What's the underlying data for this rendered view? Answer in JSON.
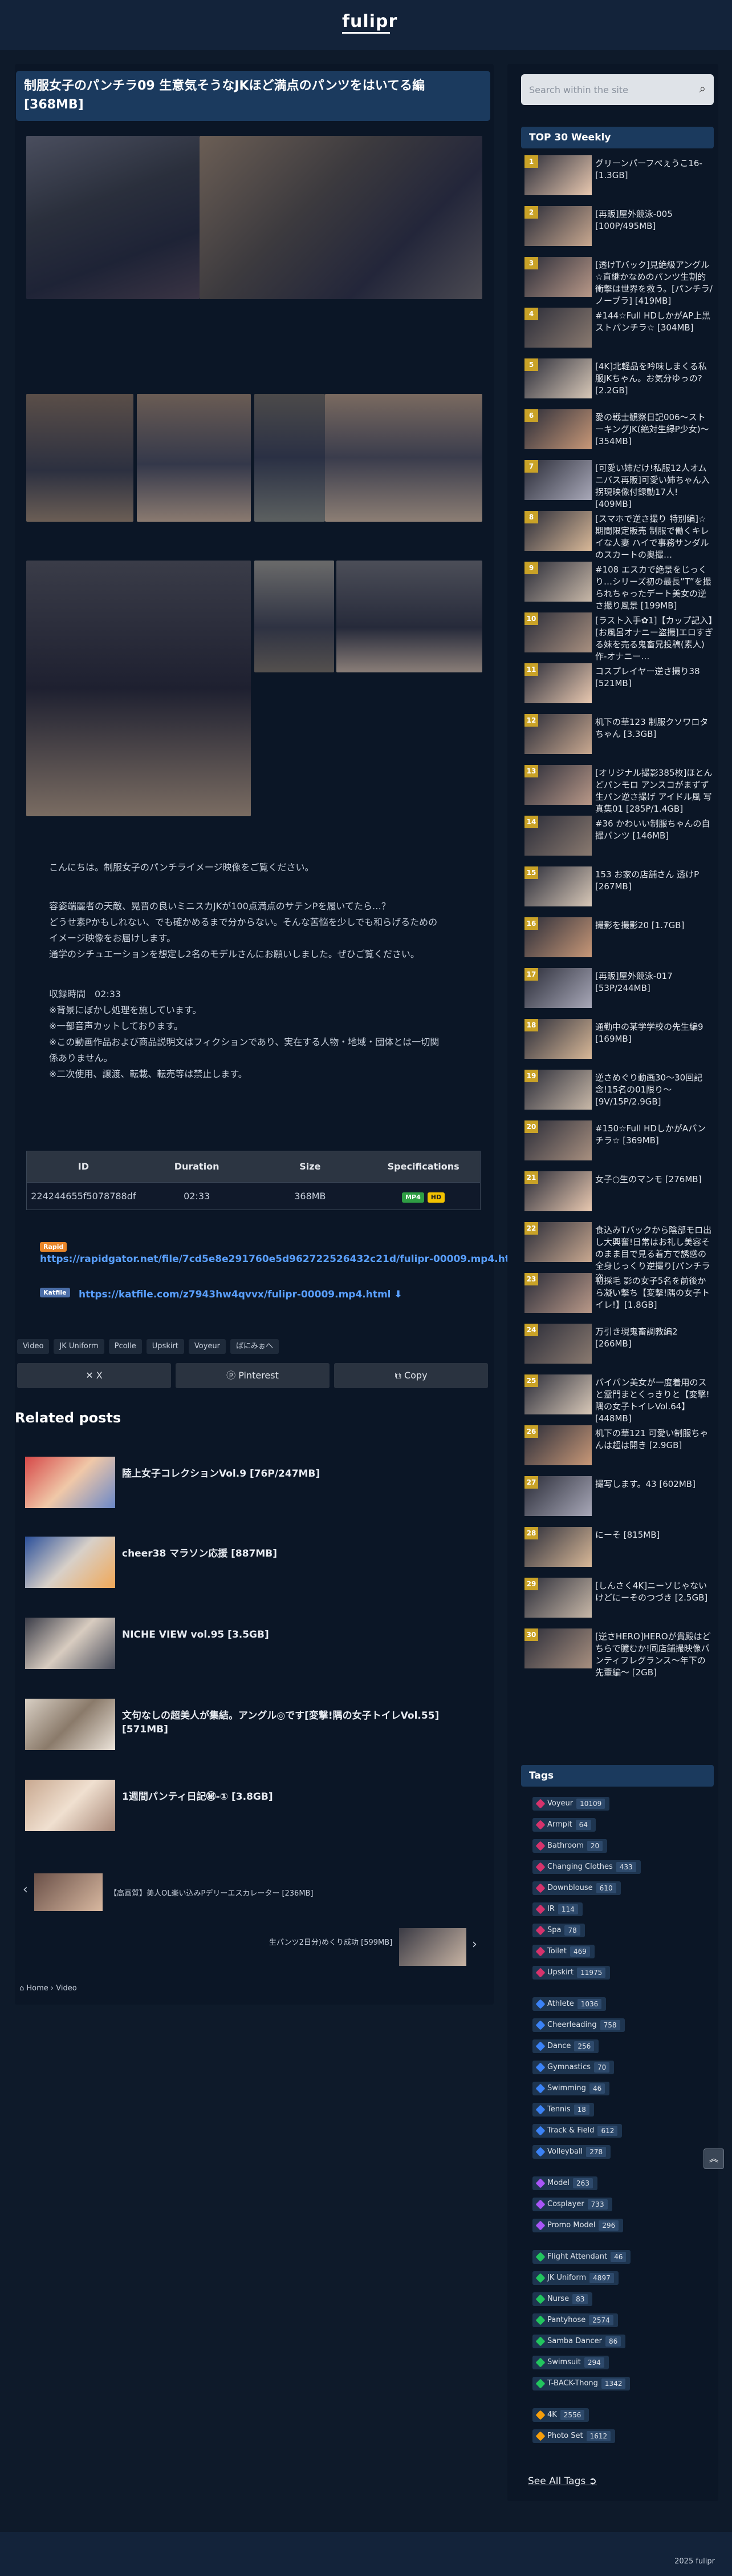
{
  "site": {
    "logo": "fulipr"
  },
  "post": {
    "title": "制服女子のパンチラ09 生意気そうなJKほど満点のパンツをはいてる編 [368MB]",
    "desc": [
      "こんにちは。制服女子のパンチライメージ映像をご覧ください。",
      "",
      "容姿端麗者の天敵、晃晋の良いミニスカJKが100点満点のサテンPを履いてたら…？",
      "どうせ素Pかもしれない、でも確かめるまで分からない。そんな苦悩を少しでも和らげるための",
      "イメージ映像をお届けします。",
      "通学のシチュエーションを想定し2名のモデルさんにお願いしました。ぜひご覧ください。",
      "",
      "収録時間　02:33",
      "※背景にぼかし処理を施しています。",
      "※一部音声カットしております。",
      "※この動画作品および商品説明文はフィクションであり、実在する人物・地域・団体とは一切関",
      "係ありません。",
      "※二次使用、譲渡、転載、転売等は禁止します。"
    ],
    "table": {
      "headers": [
        "ID",
        "Duration",
        "Size",
        "Specifications"
      ],
      "row": [
        "224244655f5078788df",
        "02:33",
        "368MB"
      ],
      "spec1": "MP4",
      "spec2": "HD"
    },
    "links": [
      {
        "badge": "Rapid",
        "url": "https://rapidgator.net/file/7cd5e8e291760e5d962722526432c21d/fulipr-00009.mp4.html ⬇"
      },
      {
        "badge": "Katfile",
        "url": "https://katfile.com/z7943hw4qvvx/fulipr-00009.mp4.html ⬇"
      }
    ],
    "tags": [
      "Video",
      "JK Uniform",
      "Pcolle",
      "Upskirt",
      "Voyeur",
      "ぱにみぉへ"
    ],
    "share": [
      "X",
      "Pinterest",
      "Copy"
    ]
  },
  "related": {
    "heading": "Related posts",
    "items": [
      "陸上女子コレクションVol.9 [76P/247MB]",
      "cheer38 マラソン応援 [887MB]",
      "NICHE VIEW vol.95 [3.5GB]",
      "文句なしの超美人が集結。アングル◎です[変撃!隅の女子トイレVol.55] [571MB]",
      "1週間パンティ日記㊙-① [3.8GB]"
    ]
  },
  "nav": {
    "prev": "【高画質】美人OL楽い込みPデリーエスカレーター [236MB]",
    "next": "生パンツ2日分)めくり成功 [599MB]"
  },
  "breadcrumb": {
    "home": "Home",
    "section": "Video"
  },
  "sidebar": {
    "search_placeholder": "Search within the site",
    "top_heading": "TOP 30 Weekly",
    "top": [
      "グリーンパーフぺぇうこ16-[1.3GB]",
      "[再販]屋外競泳-005 [100P/495MB]",
      "[透けTバック]見絶級アングル☆直継かなめのパンツ生割的衝撃は世界を救う。[パンチラ/ノーブラ] [419MB]",
      "#144☆Full HDしかがAP上黒ストパンチラ☆ [304MB]",
      "[4K]北軽品を吟味しまくる私服JKちゃん。お気分ゆっの? [2.2GB]",
      "愛の戦士観察日記006〜ストーキングJK(絶対生緑P少女)〜 [354MB]",
      "[可愛い姉だけ!私服12人オムニバス再販]可愛い姉ちゃん入拐現映像付録動17人! [409MB]",
      "[スマホで逆さ撮り 特別編]☆期間限定販売 制服で働くキレイな人妻 ハイで事務サンダルのスカートの奥撮…",
      "#108 エスカで絶景をじっくり…シリーズ初の最長”T”を撮られちゃったデート美女の逆さ撮り風景 [199MB]",
      "[ラスト入手✿1]【カップ記入】[お風呂オナニー盗撮]エロすぎる妹を売る鬼畜兄投稿(素人)作-オナニー…",
      "コスプレイヤー逆さ撮り38 [521MB]",
      "机下の華123 制服クソワロタちゃん [3.3GB]",
      "[オリジナル撮影385枚]ほとんどパンモロ アンスコがまずず生パン逆さ撮げ アイドル風 写真集01 [285P/1.4GB]",
      "#36 かわいい制服ちゃんの自撮パンツ [146MB]",
      "153 お家の店舗さん 透けP [267MB]",
      "撮影を撮影20 [1.7GB]",
      "[再販]屋外競泳-017 [53P/244MB]",
      "通勤中の某学学校の先生編9 [169MB]",
      "逆さめぐり動画30〜30回記念!15名の01限り〜[9V/15P/2.9GB]",
      "#150☆Full HDしかがAパンチラ☆ [369MB]",
      "女子○生のマンモ [276MB]",
      "食込みTバックから陰部モロ出し大興奮!日常はお礼し美容そのまま目で見る着方で誘惑の全身じっくり逆撮り[パンチラ盗…",
      "初採毛 影の女子5名を前後から凝い撃ち【変撃!隅の女子トイレ!】[1.8GB]",
      "万引き現鬼畜調教編2 [266MB]",
      "パイパン美女が一度着用のスと霊門まとくっきりと【変撃!隅の女子トイレVol.64】[448MB]",
      "机下の華121 可愛い制服ちゃんは超は開き [2.9GB]",
      "撮写します。43 [602MB]",
      "にーそ [815MB]",
      "[しんさく4K]ニーソじゃないけどにーそのつづき [2.5GB]",
      "[逆さHERO]HEROが貴殿はどちらで臆むか!同店舗撮映像パンティフレグランス〜年下の先輩編〜 [2GB]"
    ],
    "tags_heading": "Tags",
    "tags": [
      {
        "name": "Voyeur",
        "count": "10109",
        "color": "#d6336c"
      },
      {
        "name": "Armpit",
        "count": "64",
        "color": "#d6336c"
      },
      {
        "name": "Bathroom",
        "count": "20",
        "color": "#d6336c"
      },
      {
        "name": "Changing Clothes",
        "count": "433",
        "color": "#d6336c"
      },
      {
        "name": "Downblouse",
        "count": "610",
        "color": "#d6336c"
      },
      {
        "name": "IR",
        "count": "114",
        "color": "#d6336c"
      },
      {
        "name": "Spa",
        "count": "78",
        "color": "#d6336c"
      },
      {
        "name": "Toilet",
        "count": "469",
        "color": "#d6336c"
      },
      {
        "name": "Upskirt",
        "count": "11975",
        "color": "#d6336c"
      },
      {
        "name": "Athlete",
        "count": "1036",
        "color": "#3b82f6"
      },
      {
        "name": "Cheerleading",
        "count": "758",
        "color": "#3b82f6"
      },
      {
        "name": "Dance",
        "count": "256",
        "color": "#3b82f6"
      },
      {
        "name": "Gymnastics",
        "count": "70",
        "color": "#3b82f6"
      },
      {
        "name": "Swimming",
        "count": "46",
        "color": "#3b82f6"
      },
      {
        "name": "Tennis",
        "count": "18",
        "color": "#3b82f6"
      },
      {
        "name": "Track & Field",
        "count": "612",
        "color": "#3b82f6"
      },
      {
        "name": "Volleyball",
        "count": "278",
        "color": "#3b82f6"
      },
      {
        "name": "Model",
        "count": "263",
        "color": "#a855f7"
      },
      {
        "name": "Cosplayer",
        "count": "733",
        "color": "#a855f7"
      },
      {
        "name": "Promo Model",
        "count": "296",
        "color": "#a855f7"
      },
      {
        "name": "Flight Attendant",
        "count": "46",
        "color": "#22c55e"
      },
      {
        "name": "JK Uniform",
        "count": "4897",
        "color": "#22c55e"
      },
      {
        "name": "Nurse",
        "count": "83",
        "color": "#22c55e"
      },
      {
        "name": "Pantyhose",
        "count": "2574",
        "color": "#22c55e"
      },
      {
        "name": "Samba Dancer",
        "count": "86",
        "color": "#22c55e"
      },
      {
        "name": "Swimsuit",
        "count": "294",
        "color": "#22c55e"
      },
      {
        "name": "T-BACK-Thong",
        "count": "1342",
        "color": "#22c55e"
      },
      {
        "name": "4K",
        "count": "2556",
        "color": "#f59e0b"
      },
      {
        "name": "Photo Set",
        "count": "1612",
        "color": "#f59e0b"
      }
    ],
    "see_all": "See All Tags ➲"
  },
  "footer": {
    "copyright": "2025 fulipr"
  }
}
